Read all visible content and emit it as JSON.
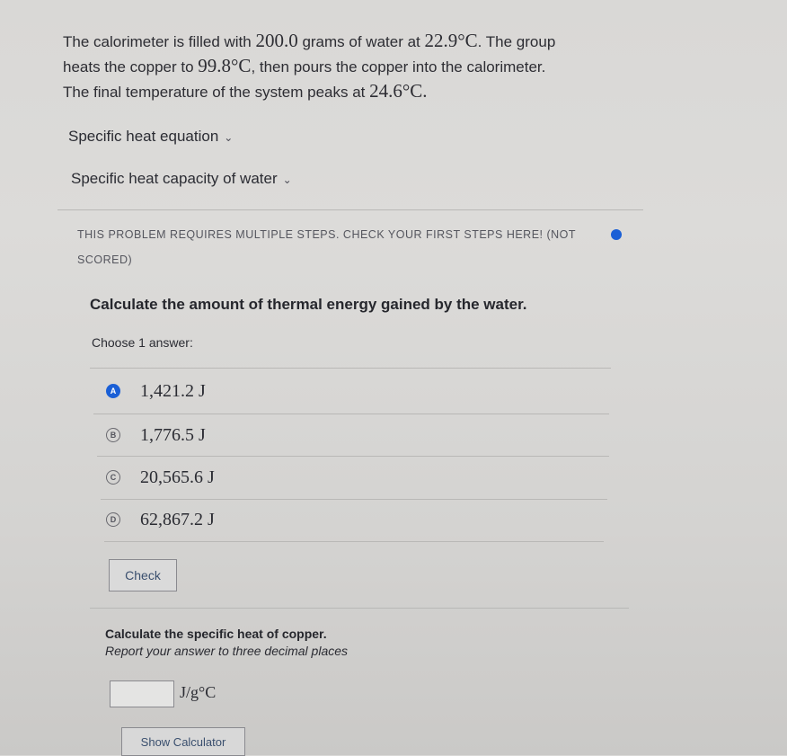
{
  "problem": {
    "l1a": "The calorimeter is filled with ",
    "mass": "200.0",
    "l1b": " grams of water at ",
    "t1": "22.9°C",
    "l1c": ". The group",
    "l2a": "heats the copper to ",
    "t2": "99.8°C",
    "l2b": ", then pours the copper into the calorimeter.",
    "l3a": "The final temperature of the system peaks at ",
    "t3": "24.6°C."
  },
  "toggles": {
    "specific_heat_equation": "Specific heat equation",
    "specific_heat_water": "Specific heat capacity of water"
  },
  "notice": "THIS PROBLEM REQUIRES MULTIPLE STEPS. CHECK YOUR FIRST STEPS HERE! (NOT SCORED)",
  "question": "Calculate the amount of thermal energy gained by the water.",
  "choose_label": "Choose 1 answer:",
  "choices": [
    {
      "letter": "A",
      "value": "1,421.2 J"
    },
    {
      "letter": "B",
      "value": "1,776.5 J"
    },
    {
      "letter": "C",
      "value": "20,565.6 J"
    },
    {
      "letter": "D",
      "value": "62,867.2 J"
    }
  ],
  "selected_letter": "A",
  "check_label": "Check",
  "part2": {
    "question": "Calculate the specific heat of copper.",
    "instruction": "Report your answer to three decimal places",
    "input_value": "",
    "unit": "J/g°C"
  },
  "calculator_label": "Show Calculator",
  "colors": {
    "accent": "#1a5fd6"
  }
}
